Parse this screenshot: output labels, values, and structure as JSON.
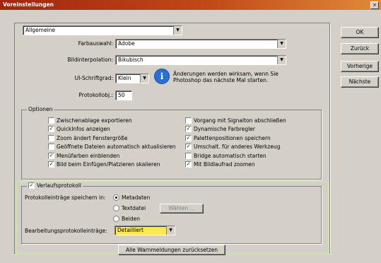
{
  "window": {
    "title": "Voreinstellungen",
    "close_glyph": "×"
  },
  "section_select": {
    "value": "Allgemeine"
  },
  "buttons": {
    "ok": "OK",
    "back": "Zurück",
    "prev": "Vorherige",
    "next": "Nächste"
  },
  "general": {
    "color_picker": {
      "label": "Farbauswahl:",
      "value": "Adobe"
    },
    "interpolation": {
      "label": "Bildinterpolation:",
      "value": "Bikubisch"
    },
    "ui_font": {
      "label": "UI-Schriftgrad:",
      "value": "Klein"
    },
    "info_icon": "info-icon",
    "restart_note": "Änderungen werden wirksam, wenn Sie Photoshop das nächste Mal starten.",
    "history_states": {
      "label": "Protokollobj.:",
      "value": "50"
    }
  },
  "options": {
    "legend": "Optionen",
    "left": [
      {
        "label": "Zwischenablage exportieren",
        "checked": false
      },
      {
        "label": "QuickInfos anzeigen",
        "checked": true
      },
      {
        "label": "Zoom ändert Fenstergröße",
        "checked": false
      },
      {
        "label": "Geöffnete Dateien automatisch aktualisieren",
        "checked": false
      },
      {
        "label": "Menüfarben einblenden",
        "checked": true
      },
      {
        "label": "Bild beim Einfügen/Platzieren skalieren",
        "checked": true
      }
    ],
    "right": [
      {
        "label": "Vorgang mit Signalton abschließen",
        "checked": false
      },
      {
        "label": "Dynamische Farbregler",
        "checked": true
      },
      {
        "label": "Palettenpositionen speichern",
        "checked": true
      },
      {
        "label": "Umschalt. für anderes Werkzeug",
        "checked": true
      },
      {
        "label": "Bridge automatisch starten",
        "checked": false
      },
      {
        "label": "Mit Bildlaufrad zoomen",
        "checked": true
      }
    ]
  },
  "history_log": {
    "checkbox_label": "Verlaufsprotokoll",
    "checked": true,
    "save_in_label": "Protokolleinträge speichern in:",
    "radio_metadata": "Metadaten",
    "radio_textfile": "Textdatei",
    "radio_both": "Beiden",
    "choose_button": "Wählen ...",
    "edit_entries_label": "Bearbeitungsprotokolleinträge:",
    "edit_entries_value": "Detailliert"
  },
  "reset_warnings": "Alle Warnmeldungen zurücksetzen"
}
